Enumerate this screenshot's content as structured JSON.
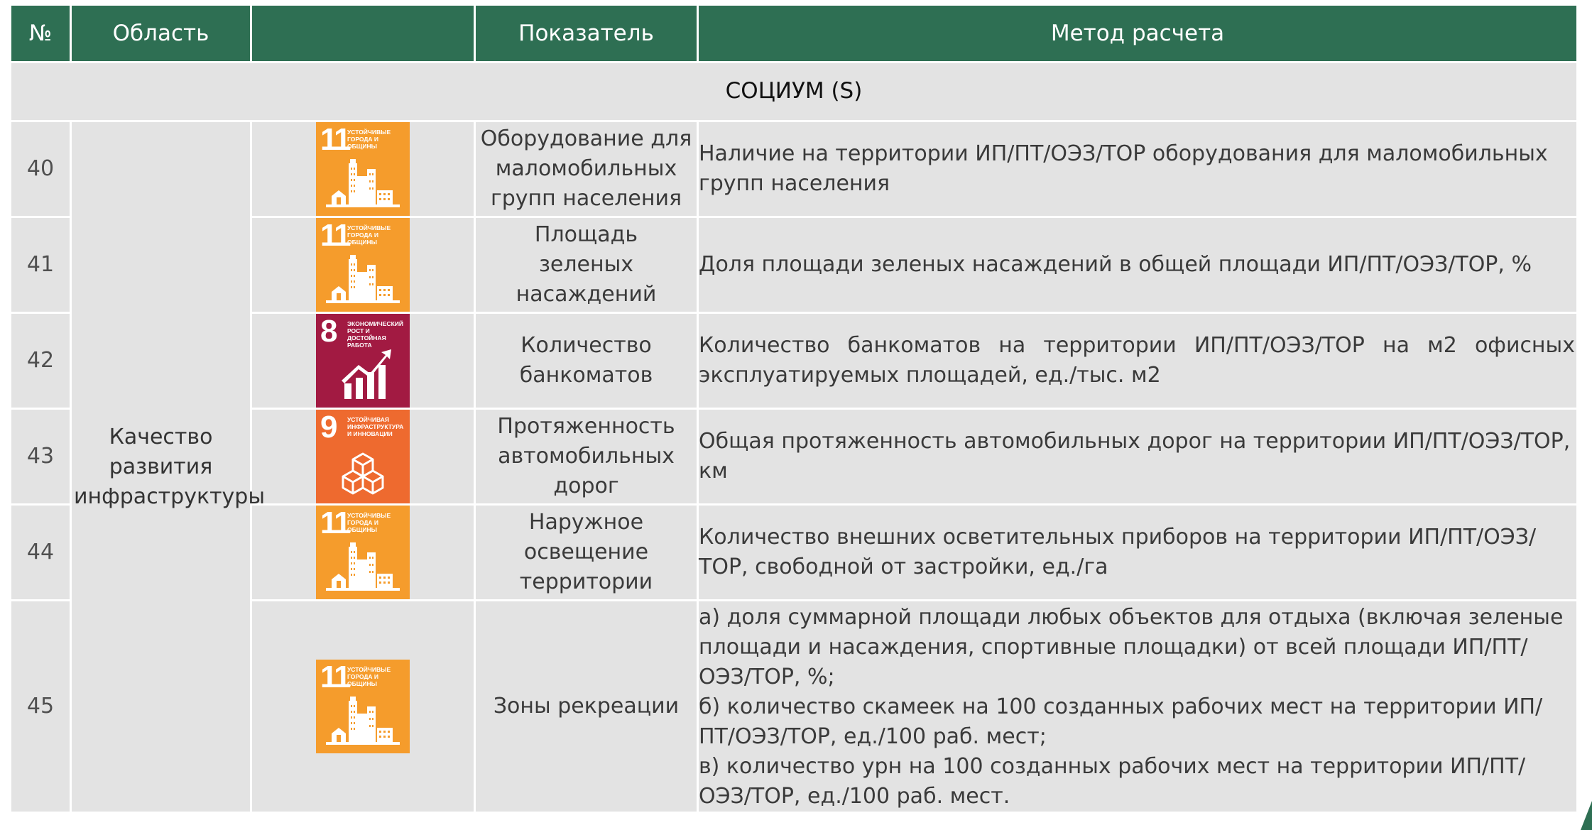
{
  "header": {
    "num": "№",
    "area": "Область",
    "icon": "",
    "indicator": "Показатель",
    "method": "Метод расчета"
  },
  "section": "СОЦИУМ (S)",
  "area_label": "Качество развития инфраструктуры",
  "colors": {
    "header_bg": "#2e6f53",
    "cell_bg": "#e3e3e3",
    "sdg11": "#f59c2c",
    "sdg8": "#a21a42",
    "sdg9": "#ee6a2f"
  },
  "sdg": {
    "g11": {
      "number": "11",
      "title": "Устойчивые города и общины",
      "icon": "city-buildings-icon"
    },
    "g8": {
      "number": "8",
      "title": "Экономический рост и достойная работа",
      "icon": "growth-chart-icon"
    },
    "g9": {
      "number": "9",
      "title": "Устойчивая инфраструктура и инновации",
      "icon": "cubes-icon"
    }
  },
  "rows": [
    {
      "num": "40",
      "indicator": "Оборудование для маломобильных групп населения",
      "method": [
        "Наличие на территории ИП/ПТ/ОЭЗ/ТОР оборудования для маломобильных групп населения"
      ]
    },
    {
      "num": "41",
      "indicator": "Площадь зеленых насаждений",
      "method": [
        "Доля площади зеленых насаждений в общей площади ИП/ПТ/ОЭЗ/ТОР, %"
      ]
    },
    {
      "num": "42",
      "indicator": "Количество банкоматов",
      "method": [
        "Количество банкоматов на территории ИП/ПТ/ОЭЗ/ТОР на м2 офисных эксплуатируемых площадей, ед./тыс. м2"
      ]
    },
    {
      "num": "43",
      "indicator": "Протяженность автомобильных дорог",
      "method": [
        "Общая протяженность автомобильных дорог на территории ИП/ПТ/ОЭЗ/ТОР, км"
      ]
    },
    {
      "num": "44",
      "indicator": "Наружное освещение территории",
      "method": [
        "Количество внешних осветительных приборов на территории ИП/ПТ/ОЭЗ/ТОР, свободной от застройки, ед./га"
      ]
    },
    {
      "num": "45",
      "indicator": "Зоны рекреации",
      "method": [
        "а) доля суммарной площади любых объектов для отдыха (включая зеленые площади и насаждения, спортивные площадки) от всей площади ИП/ПТ/ОЭЗ/ТОР, %;",
        "б) количество скамеек на 100 созданных рабочих мест на территории ИП/ПТ/ОЭЗ/ТОР, ед./100 раб. мест;",
        "в) количество урн на 100 созданных рабочих мест на территории ИП/ПТ/ОЭЗ/ТОР, ед./100 раб. мест."
      ]
    }
  ]
}
